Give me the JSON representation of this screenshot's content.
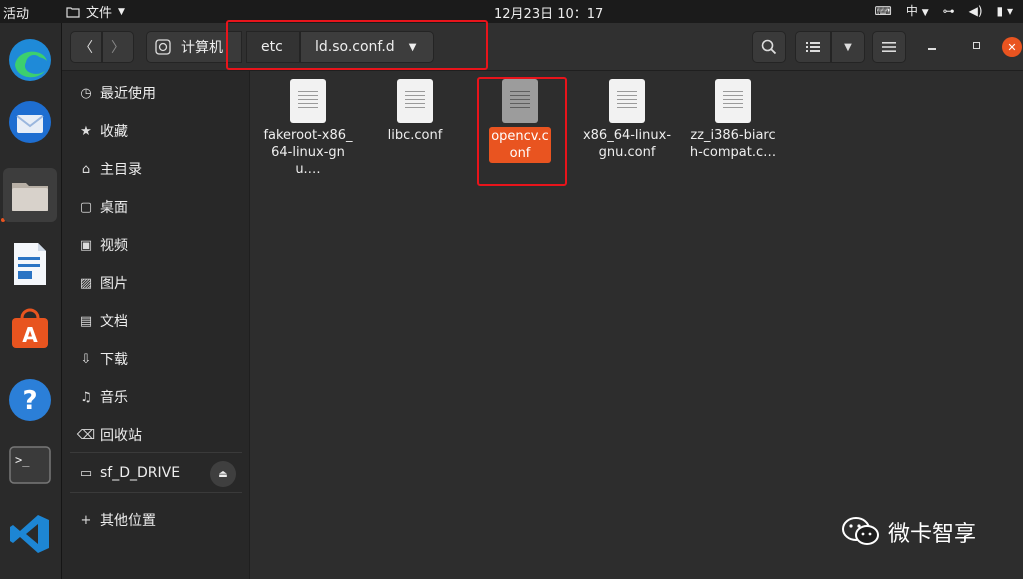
{
  "topbar": {
    "activities": "活动",
    "app_menu": "文件",
    "clock": "12月23日  10：17",
    "input_method": "中"
  },
  "window": {
    "breadcrumb": {
      "computer": "计算机",
      "etc": "etc",
      "current": "ld.so.conf.d"
    }
  },
  "sidebar": {
    "items": [
      {
        "label": "最近使用",
        "icon": "clock-icon"
      },
      {
        "label": "收藏",
        "icon": "star-icon"
      },
      {
        "label": "主目录",
        "icon": "home-icon"
      },
      {
        "label": "桌面",
        "icon": "desktop-icon"
      },
      {
        "label": "视频",
        "icon": "video-icon"
      },
      {
        "label": "图片",
        "icon": "image-icon"
      },
      {
        "label": "文档",
        "icon": "document-icon"
      },
      {
        "label": "下载",
        "icon": "download-icon"
      },
      {
        "label": "音乐",
        "icon": "music-icon"
      },
      {
        "label": "回收站",
        "icon": "trash-icon"
      }
    ],
    "drive": "sf_D_DRIVE",
    "other_locations": "其他位置"
  },
  "files": [
    {
      "name": "fakeroot-x86_64-linux-gnu.…",
      "selected": false
    },
    {
      "name": "libc.conf",
      "selected": false
    },
    {
      "name": "opencv.conf",
      "selected": true
    },
    {
      "name": "x86_64-linux-gnu.conf",
      "selected": false
    },
    {
      "name": "zz_i386-biarch-compat.c…",
      "selected": false
    }
  ],
  "watermark": "微卡智享",
  "colors": {
    "accent": "#e95420",
    "highlight_box": "#e8141b"
  }
}
